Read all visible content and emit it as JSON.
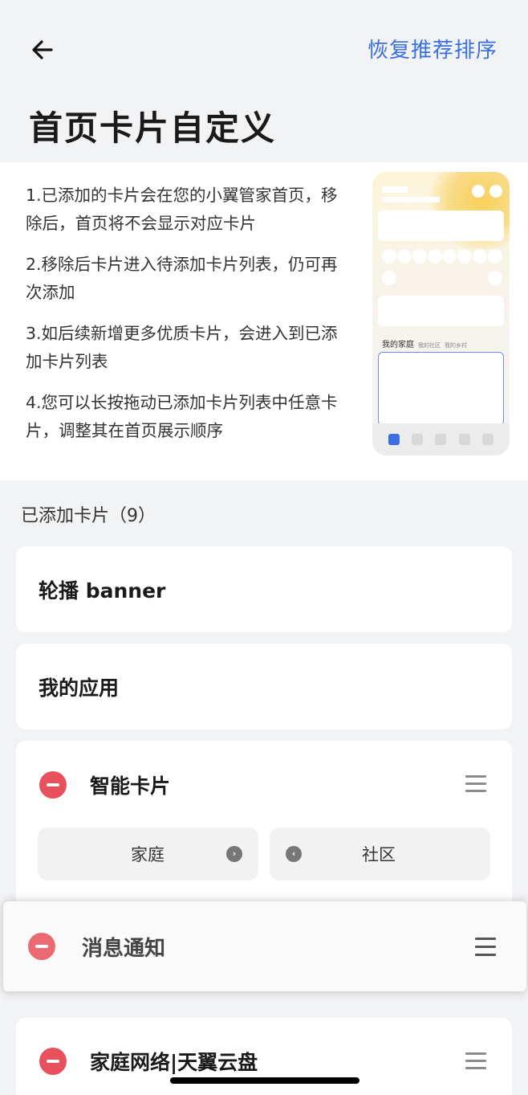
{
  "header": {
    "back_icon": "arrow-left-icon",
    "restore_label": "恢复推荐排序",
    "title": "首页卡片自定义"
  },
  "intro": {
    "items": [
      "1.已添加的卡片会在您的小翼管家首页，移除后，首页将不会显示对应卡片",
      "2.移除后卡片进入待添加卡片列表，仍可再次添加",
      "3.如后续新增更多优质卡片，会进入到已添加卡片列表",
      "4.您可以长按拖动已添加卡片列表中任意卡片，调整其在首页展示顺序"
    ],
    "preview": {
      "tab_main": "我的家庭",
      "tab_2": "我的社区",
      "tab_3": "我的乡村"
    }
  },
  "added": {
    "section_title": "已添加卡片（9）",
    "cards": [
      {
        "title": "轮播 banner"
      },
      {
        "title": "我的应用"
      },
      {
        "title": "智能卡片",
        "sub_items": [
          {
            "label": "家庭",
            "icon": "chevron-right-icon"
          },
          {
            "label": "社区",
            "icon": "chevron-left-icon"
          }
        ]
      },
      {
        "title": "消息通知"
      },
      {
        "title": "家庭网络|天翼云盘"
      }
    ]
  },
  "colors": {
    "accent": "#3a6fe0",
    "remove": "#e8505b",
    "background": "#f2f3f5"
  }
}
